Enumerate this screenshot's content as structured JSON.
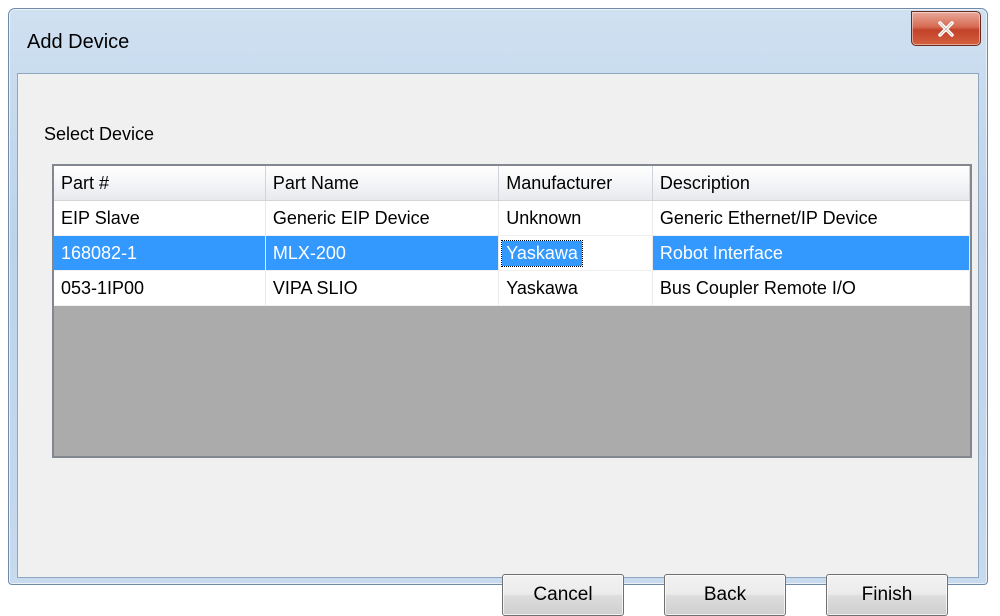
{
  "window": {
    "title": "Add Device",
    "close_label": "x"
  },
  "section_label": "Select Device",
  "table": {
    "columns": [
      "Part #",
      "Part Name",
      "Manufacturer",
      "Description"
    ],
    "rows": [
      {
        "part_number": "EIP Slave",
        "part_name": "Generic EIP Device",
        "manufacturer": "Unknown",
        "description": "Generic Ethernet/IP Device",
        "selected": false
      },
      {
        "part_number": "168082-1",
        "part_name": "MLX-200",
        "manufacturer": "Yaskawa",
        "description": "Robot Interface",
        "selected": true
      },
      {
        "part_number": "053-1IP00",
        "part_name": "VIPA SLIO",
        "manufacturer": "Yaskawa",
        "description": "Bus Coupler Remote I/O",
        "selected": false
      }
    ]
  },
  "buttons": {
    "cancel": "Cancel",
    "back": "Back",
    "finish": "Finish"
  },
  "colors": {
    "selection": "#3399ff",
    "grid_empty": "#ababab",
    "close_button": "#c2422a"
  }
}
